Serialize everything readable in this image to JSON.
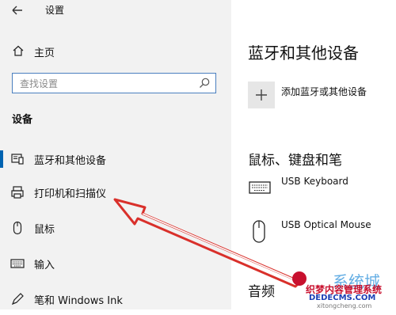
{
  "window": {
    "title": "设置"
  },
  "sidebar": {
    "home_label": "主页",
    "search_placeholder": "查找设置",
    "section_title": "设备",
    "items": [
      {
        "label": "蓝牙和其他设备",
        "icon": "bluetooth-devices-icon",
        "selected": true
      },
      {
        "label": "打印机和扫描仪",
        "icon": "printer-icon",
        "selected": false
      },
      {
        "label": "鼠标",
        "icon": "mouse-icon",
        "selected": false
      },
      {
        "label": "输入",
        "icon": "keyboard-icon",
        "selected": false
      },
      {
        "label": "笔和 Windows Ink",
        "icon": "pen-icon",
        "selected": false
      }
    ]
  },
  "main": {
    "page_title": "蓝牙和其他设备",
    "add_device_label": "添加蓝牙或其他设备",
    "section_input_title": "鼠标、键盘和笔",
    "devices": [
      {
        "name": "USB Keyboard",
        "icon": "keyboard-icon"
      },
      {
        "name": "USB Optical Mouse",
        "icon": "mouse-icon"
      }
    ],
    "section_audio_title": "音频"
  },
  "overlay": {
    "annotation": "red-arrow-pointing-to-printers",
    "watermark_lines": [
      "系统城",
      "xitongcheng.com"
    ],
    "watermark_lines_2": [
      "织梦内容管理系统",
      "DEDECMS.COM"
    ]
  },
  "colors": {
    "sidebar_bg": "#f2f2f2",
    "accent": "#0063b1",
    "search_border": "#4a7fbf",
    "arrow": "#d9302b"
  }
}
